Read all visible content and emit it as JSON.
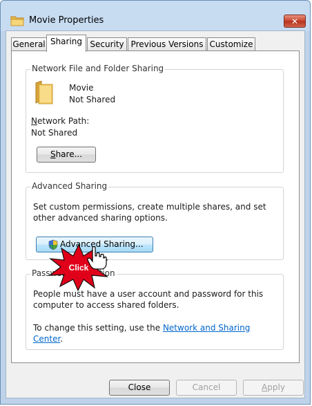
{
  "window": {
    "title": "Movie Properties",
    "close_glyph": "✕"
  },
  "tabs": [
    {
      "label": "General"
    },
    {
      "label": "Sharing"
    },
    {
      "label": "Security"
    },
    {
      "label": "Previous Versions"
    },
    {
      "label": "Customize"
    }
  ],
  "network_sharing": {
    "group_label": "Network File and Folder Sharing",
    "folder_name": "Movie",
    "folder_status": "Not Shared",
    "path_label_accel": "N",
    "path_label_rest": "etwork Path:",
    "path_value": "Not Shared",
    "share_button_accel": "S",
    "share_button_rest": "hare..."
  },
  "advanced_sharing": {
    "group_label": "Advanced Sharing",
    "description": "Set custom permissions, create multiple shares, and set other advanced sharing options.",
    "button_label": "Advanced Sharing...",
    "overlay_text": "Click"
  },
  "password_protection": {
    "group_label": "Password Protection",
    "description": "People must have a user account and password for this computer to access shared folders.",
    "change_text": "To change this setting, use the ",
    "link_text": "Network and Sharing Center",
    "change_suffix": "."
  },
  "footer": {
    "close_label": "Close",
    "cancel_label": "Cancel",
    "apply_accel": "A",
    "apply_rest": "pply"
  },
  "colors": {
    "overlay_red": "#e0001a",
    "link_blue": "#0066cc"
  },
  "icons": {
    "title": "folder-icon",
    "folder": "folder-icon",
    "shield": "uac-shield-icon",
    "cursor": "hand-pointer-icon"
  }
}
